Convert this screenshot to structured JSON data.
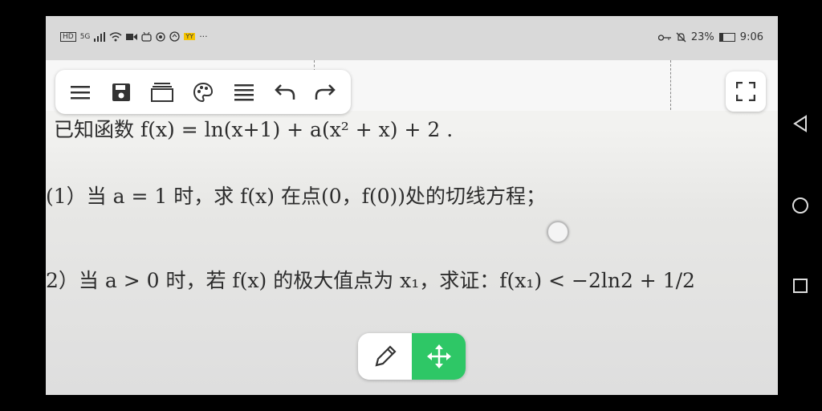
{
  "status_bar": {
    "left_badges": [
      "HD",
      "5G",
      "YY"
    ],
    "more": "···",
    "battery_percent": "23%",
    "battery_level": 0.23,
    "time": "9:06"
  },
  "toolbar": {
    "icons": [
      "menu-icon",
      "save-icon",
      "layers-icon",
      "palette-icon",
      "list-icon",
      "undo-icon",
      "redo-icon"
    ]
  },
  "document": {
    "line1": "已知函数 f(x) = ln(x+1) + a(x² + x) + 2 .",
    "line2": "(1）当 a = 1 时，求 f(x) 在点(0，f(0))处的切线方程；",
    "line3": "2）当 a > 0 时，若 f(x) 的极大值点为 x₁，求证：f(x₁) < −2ln2 + 1/2"
  },
  "colors": {
    "accent_green": "#2ec766",
    "status_bg": "#d9d9d9"
  }
}
